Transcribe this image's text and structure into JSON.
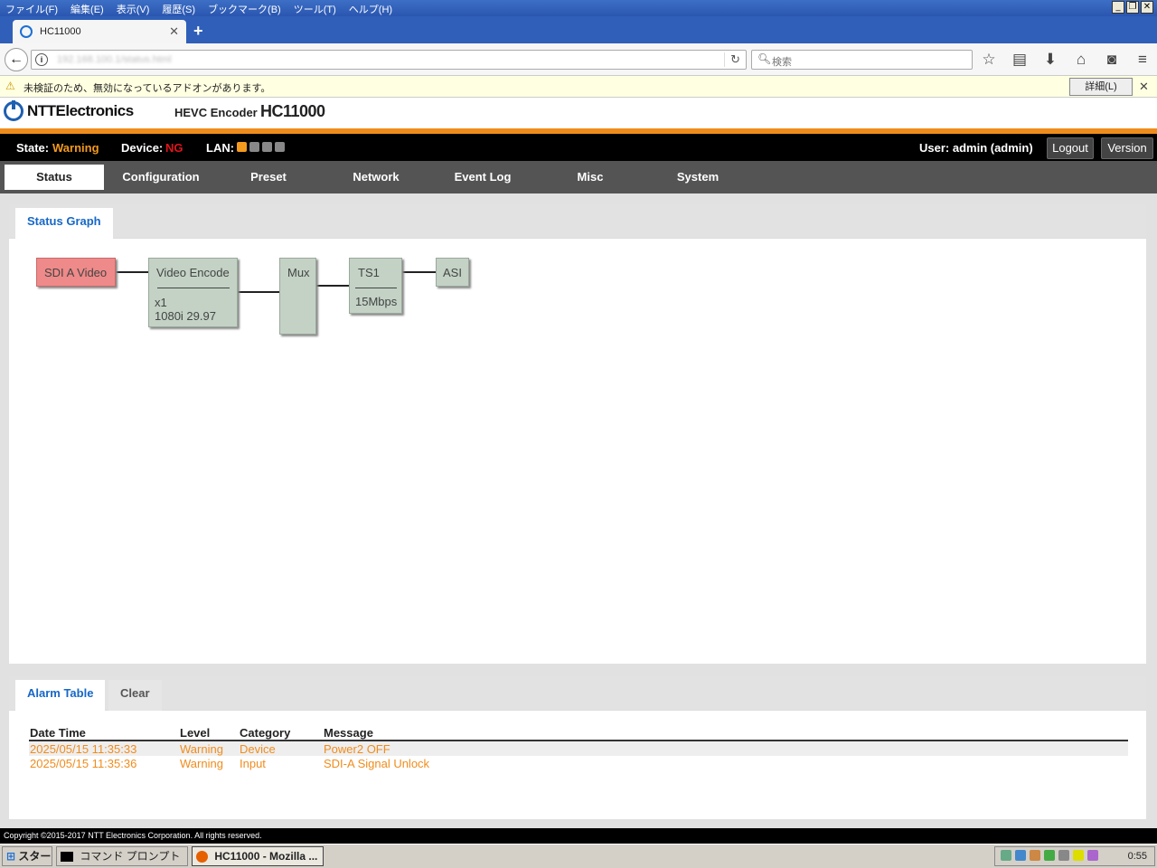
{
  "browser": {
    "menu": [
      "ファイル(F)",
      "編集(E)",
      "表示(V)",
      "履歴(S)",
      "ブックマーク(B)",
      "ツール(T)",
      "ヘルプ(H)"
    ],
    "tab_title": "HC11000",
    "new_tab": "+",
    "url": "192.168.100.1/status.html",
    "search_placeholder": "検索",
    "notice": "未検証のため、無効になっているアドオンがあります。",
    "notice_detail_button": "詳細(L)"
  },
  "app": {
    "brand": "NTTElectronics",
    "product": "HEVC Encoder",
    "model": "HC11000"
  },
  "status": {
    "state_label": "State:",
    "state_value": "Warning",
    "device_label": "Device:",
    "device_value": "NG",
    "lan_label": "LAN:",
    "user_text": "User:  admin (admin)",
    "logout": "Logout",
    "version": "Version"
  },
  "nav": [
    "Status",
    "Configuration",
    "Preset",
    "Network",
    "Event Log",
    "Misc",
    "System"
  ],
  "graph_panel": {
    "tab": "Status Graph",
    "nodes": {
      "sdi": "SDI A Video",
      "venc_title": "Video Encode",
      "venc_line1": "x1",
      "venc_line2": "1080i 29.97",
      "mux": "Mux",
      "ts_title": "TS1",
      "ts_rate": "15Mbps",
      "asi": "ASI"
    }
  },
  "alarm_panel": {
    "tab": "Alarm Table",
    "clear": "Clear",
    "headers": [
      "Date Time",
      "Level",
      "Category",
      "Message"
    ],
    "rows": [
      [
        "2025/05/15 11:35:33",
        "Warning",
        "Device",
        "Power2 OFF"
      ],
      [
        "2025/05/15 11:35:36",
        "Warning",
        "Input",
        "SDI-A Signal Unlock"
      ]
    ]
  },
  "footer": "Copyright ©2015-2017 NTT Electronics Corporation. All rights reserved.",
  "taskbar": {
    "start": "スタート",
    "items": [
      "コマンド プロンプト",
      "HC11000 - Mozilla ..."
    ],
    "clock": "0:55"
  },
  "colors": {
    "accent": "#f08c1c",
    "error": "#e2141b",
    "link_blue": "#1667c7",
    "node_ok": "#c3d2c5",
    "node_err": "#ee8a89"
  }
}
